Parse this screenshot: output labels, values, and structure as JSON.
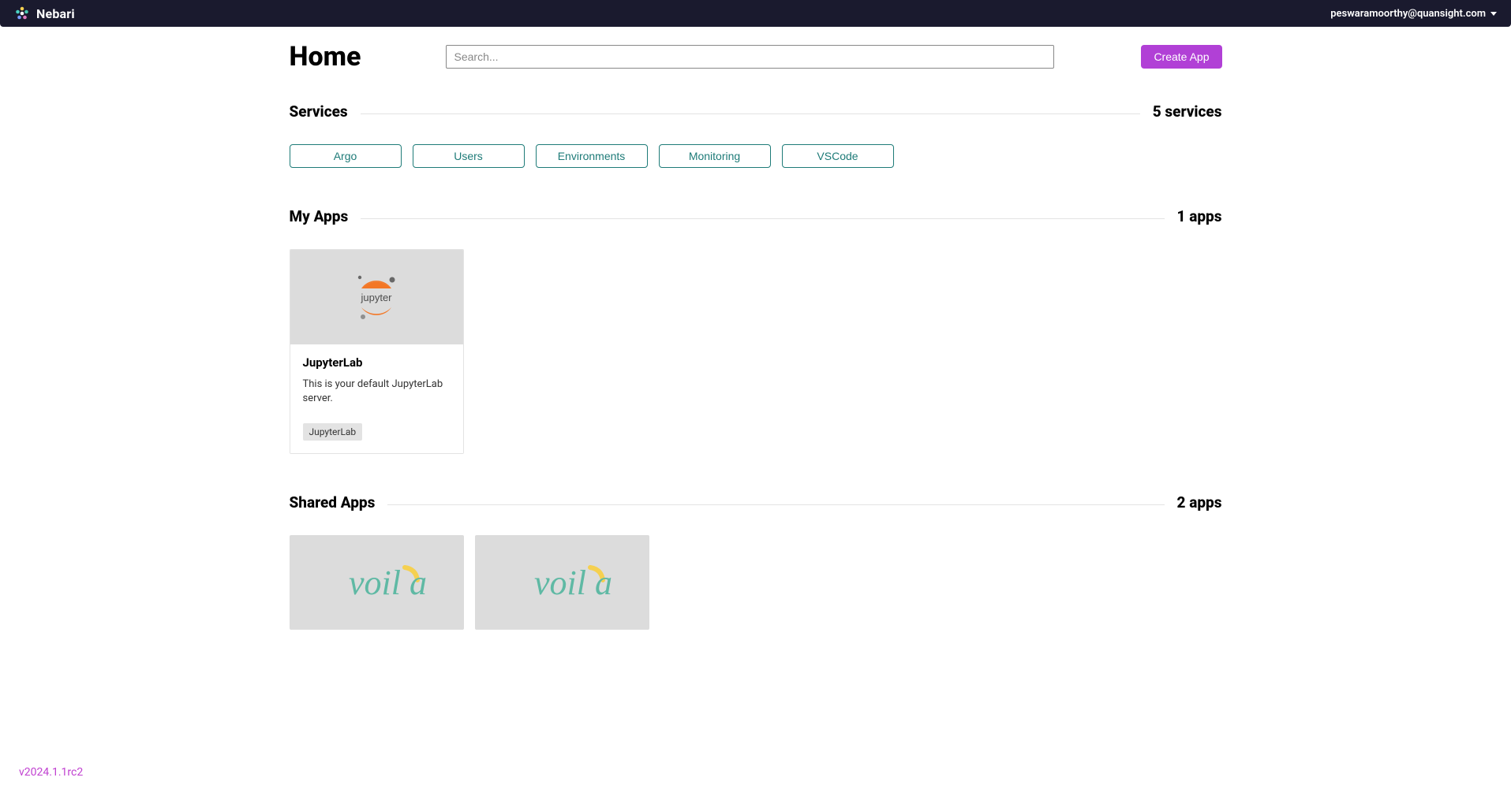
{
  "brand": "Nebari",
  "user_email": "peswaramoorthy@quansight.com",
  "page_title": "Home",
  "search": {
    "placeholder": "Search..."
  },
  "create_button": "Create App",
  "sections": {
    "services": {
      "title": "Services",
      "count_label": "5 services",
      "items": [
        "Argo",
        "Users",
        "Environments",
        "Monitoring",
        "VSCode"
      ]
    },
    "my_apps": {
      "title": "My Apps",
      "count_label": "1 apps",
      "cards": [
        {
          "title": "JupyterLab",
          "description": "This is your default JupyterLab server.",
          "tag": "JupyterLab",
          "logo": "jupyter"
        }
      ]
    },
    "shared_apps": {
      "title": "Shared Apps",
      "count_label": "2 apps",
      "cards": [
        {
          "logo": "voila"
        },
        {
          "logo": "voila"
        }
      ]
    }
  },
  "version": "v2024.1.1rc2",
  "colors": {
    "accent": "#b140d6",
    "teal": "#1e7b78",
    "voila_teal": "#5fb9a4",
    "voila_yellow": "#f5d050"
  }
}
